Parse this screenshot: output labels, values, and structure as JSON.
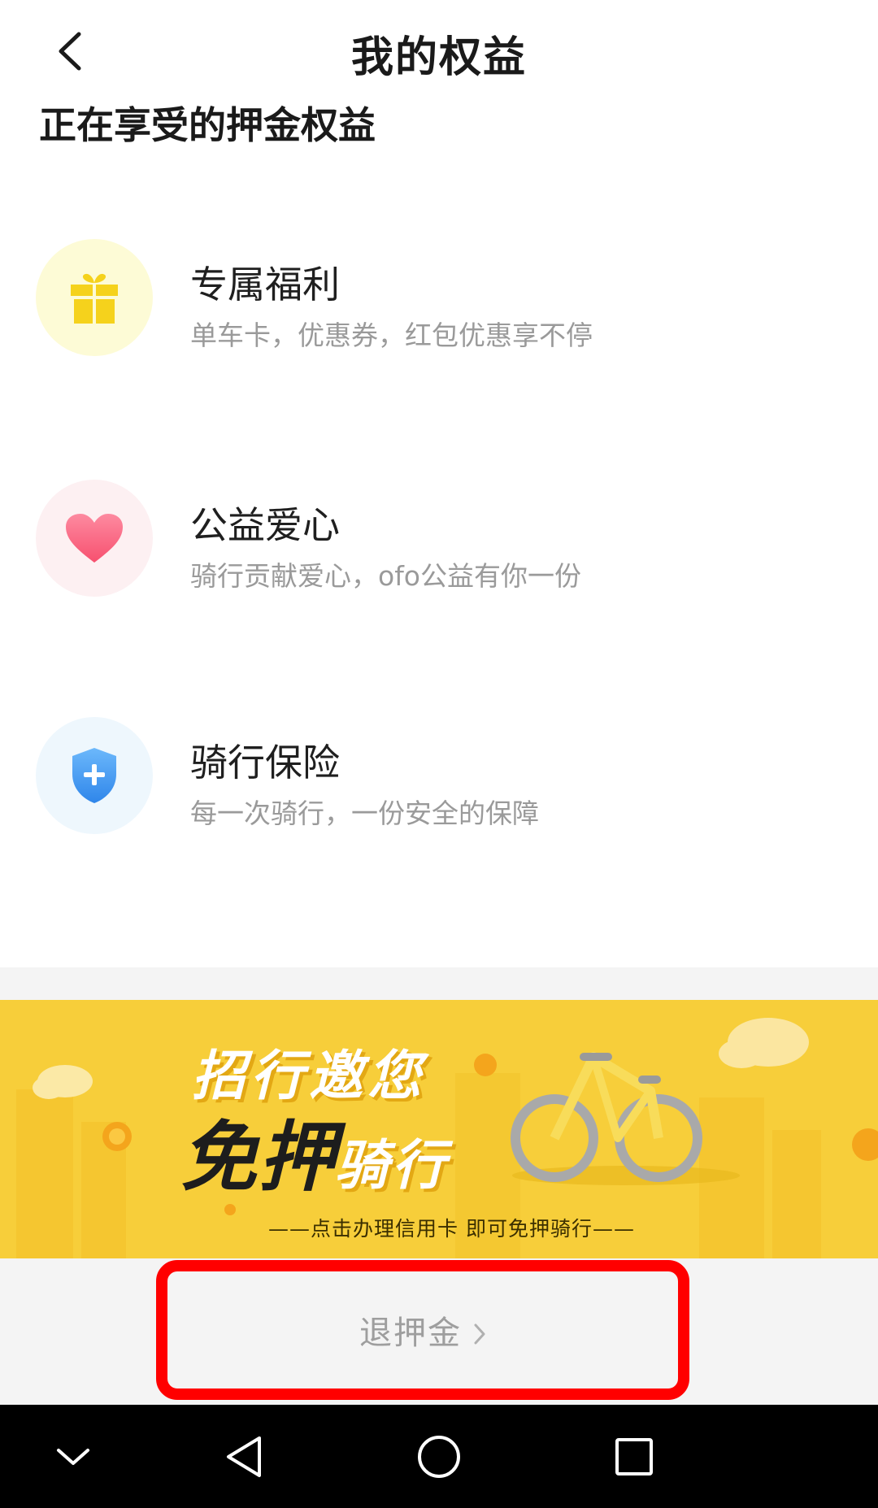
{
  "header": {
    "title": "我的权益",
    "back_icon": "back-chevron-icon"
  },
  "section_title": "正在享受的押金权益",
  "benefits": [
    {
      "name": "专属福利",
      "description": "单车卡，优惠券，红包优惠享不停",
      "icon": "gift-icon",
      "icon_color": "#f7d41f",
      "icon_bg": "#fdfbd9"
    },
    {
      "name": "公益爱心",
      "description": "骑行贡献爱心，ofo公益有你一份",
      "icon": "heart-icon",
      "icon_color": "#fb6b86",
      "icon_bg": "#fdf0f2"
    },
    {
      "name": "骑行保险",
      "description": "每一次骑行，一份安全的保障",
      "icon": "shield-plus-icon",
      "icon_color": "#4a9ff5",
      "icon_bg": "#eef7fd"
    }
  ],
  "banner": {
    "line1": "招行邀您",
    "line2_a": "免押",
    "line2_b": "骑行",
    "subtitle": "——点击办理信用卡 即可免押骑行——",
    "background": "#f7ce3a",
    "illustration": "bicycle-icon"
  },
  "refund": {
    "label": "退押金",
    "chevron": "chevron-right-icon",
    "highlight_color": "#ff0000"
  },
  "system_nav": {
    "items": [
      "collapse-icon",
      "back-triangle-icon",
      "home-circle-icon",
      "recents-square-icon"
    ]
  }
}
